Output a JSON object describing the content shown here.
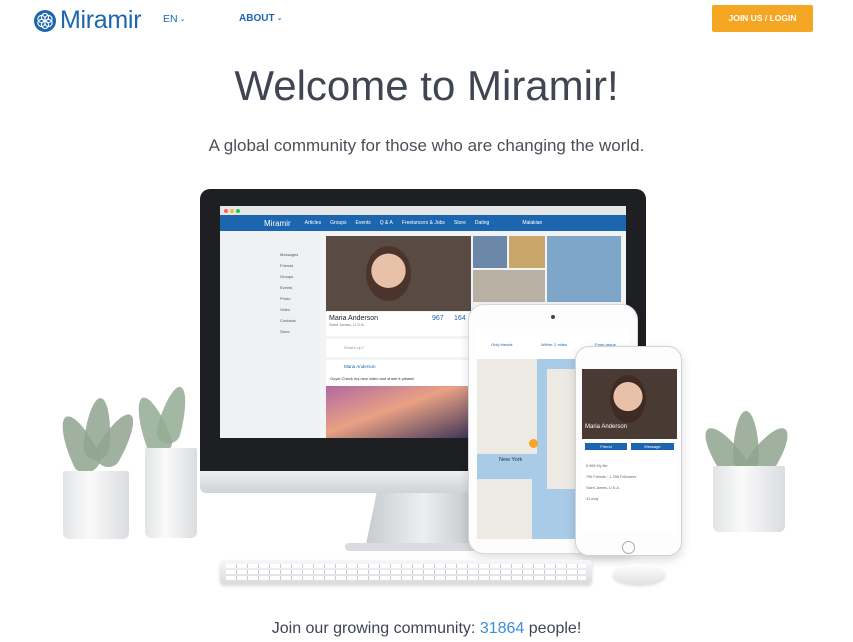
{
  "header": {
    "brand": "Miramir",
    "language": "EN",
    "about": "ABOUT",
    "join_button": "JOIN US / LOGIN"
  },
  "hero": {
    "title": "Welcome to Miramir!",
    "subtitle": "A global community for those who are changing the world."
  },
  "screen": {
    "brand": "Miramir",
    "nav": [
      "Articles",
      "Groups",
      "Events",
      "Q & A",
      "Freelancers & Jobs",
      "Store",
      "Dating"
    ],
    "user": "Malakian",
    "sidebar": [
      "Messages",
      "Friends",
      "Groups",
      "Events",
      "Photo",
      "Video",
      "Contacts",
      "Store"
    ],
    "profile_name": "Maria Anderson",
    "profile_location": "Saint James, U.S.A.",
    "stat_1": "967",
    "stat_2": "164",
    "status_placeholder": "What's up?",
    "post_author": "Maria Anderson",
    "post_text": "Guys! Check my new video and share it please!"
  },
  "tablet": {
    "filter_1": "Only friends",
    "filter_2": "Within: 2 miles",
    "filter_3": "From group",
    "map_label": "New York"
  },
  "phone": {
    "name": "Maria Anderson",
    "friend_button": "Friend",
    "message_button": "Message",
    "info_1": "5 965 My life",
    "info_2": "796 Friends · 1 298 Followers",
    "info_3": "Saint James, U.S.A.",
    "info_4": "31 may"
  },
  "footer": {
    "prefix": "Join our growing community: ",
    "count": "31864",
    "suffix": " people!"
  },
  "colors": {
    "brand_blue": "#1b66ae",
    "button_orange": "#f5a623",
    "count_blue": "#3b8fd8"
  }
}
